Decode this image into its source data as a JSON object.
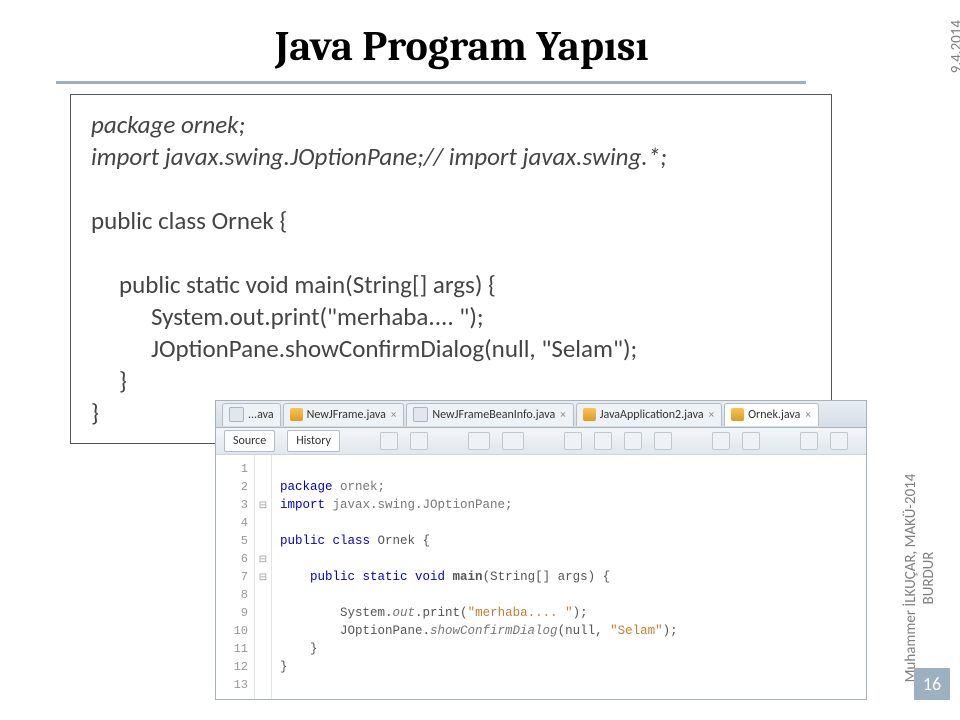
{
  "title": "Java  Program Yapısı",
  "side": {
    "date": "9.4.2014",
    "credit": "Muhammer İLKUÇAR, MAKÜ-2014  BURDUR",
    "page": "16"
  },
  "code": {
    "l1": "package ornek;",
    "l2": "import javax.swing.JOptionPane;// import javax.swing.*;",
    "l3": "public class Ornek {",
    "l4": "public static void main(String[] args) {",
    "l5": "System.out.print(\"merhaba.... \");",
    "l6": "JOptionPane.showConfirmDialog(null, \"Selam\");",
    "l7": "}",
    "l8": "}"
  },
  "ide": {
    "tabPrefix": "...ava",
    "tabs": [
      {
        "label": "NewJFrame.java",
        "icon": "j",
        "close": true,
        "active": false
      },
      {
        "label": "NewJFrameBeanInfo.java",
        "icon": "g",
        "close": true,
        "active": false
      },
      {
        "label": "JavaApplication2.java",
        "icon": "j",
        "close": true,
        "active": false
      },
      {
        "label": "Ornek.java",
        "icon": "j",
        "close": true,
        "active": true
      }
    ],
    "toolbar": {
      "source": "Source",
      "history": "History"
    },
    "lines": [
      "1",
      "2",
      "3",
      "4",
      "5",
      "6",
      "7",
      "8",
      "9",
      "10",
      "11",
      "12",
      "13"
    ],
    "fold": [
      "",
      "",
      "⊟",
      "",
      "",
      "⊟",
      "⊟",
      "",
      "",
      "",
      "",
      "",
      ""
    ],
    "src": {
      "l2_kw": "package",
      "l2_pkg": " ornek;",
      "l3_kw": "import",
      "l3_pkg": " javax.swing.JOptionPane;",
      "l5_kw": "public class ",
      "l5_cls": "Ornek",
      "l5_tr": " {",
      "l7_a": "    ",
      "l7_kw": "public static void ",
      "l7_m": "main",
      "l7_tr": "(String[] args) {",
      "l9_a": "        System.",
      "l9_out": "out",
      "l9_b": ".print(",
      "l9_s": "\"merhaba.... \"",
      "l9_c": ");",
      "l10_a": "        JOptionPane.",
      "l10_m": "showConfirmDialog",
      "l10_b": "(null, ",
      "l10_s": "\"Selam\"",
      "l10_c": ");",
      "l11": "    }",
      "l12": "}"
    }
  }
}
